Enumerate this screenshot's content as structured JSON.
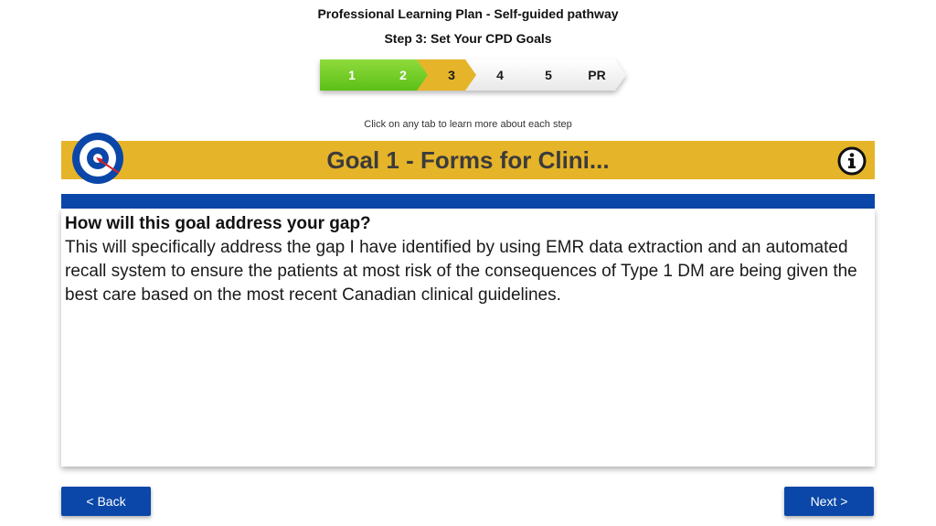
{
  "header": {
    "title": "Professional Learning Plan - Self-guided pathway",
    "step_title": "Step 3: Set Your CPD Goals"
  },
  "stepper": {
    "steps": [
      {
        "label": "1",
        "state": "done"
      },
      {
        "label": "2",
        "state": "done"
      },
      {
        "label": "3",
        "state": "current"
      },
      {
        "label": "4",
        "state": "todo"
      },
      {
        "label": "5",
        "state": "todo"
      },
      {
        "label": "PR",
        "state": "todo"
      }
    ],
    "hint": "Click on any tab to learn more about each step"
  },
  "goal": {
    "title": "Goal 1 - Forms for Clini...",
    "icon": "target-icon",
    "info_icon": "info-icon"
  },
  "content": {
    "question": "How will this goal address your gap?",
    "answer": "This will specifically address the gap I have identified by using EMR data extraction and an automated recall system to ensure the patients at most risk of the consequences of Type 1 DM are being given the best care based on the most recent Canadian clinical guidelines."
  },
  "nav": {
    "back_label": "< Back",
    "next_label": "Next >"
  },
  "colors": {
    "accent_gold": "#e6b429",
    "brand_blue": "#0b47a8",
    "done_green": "#6cc71f"
  }
}
